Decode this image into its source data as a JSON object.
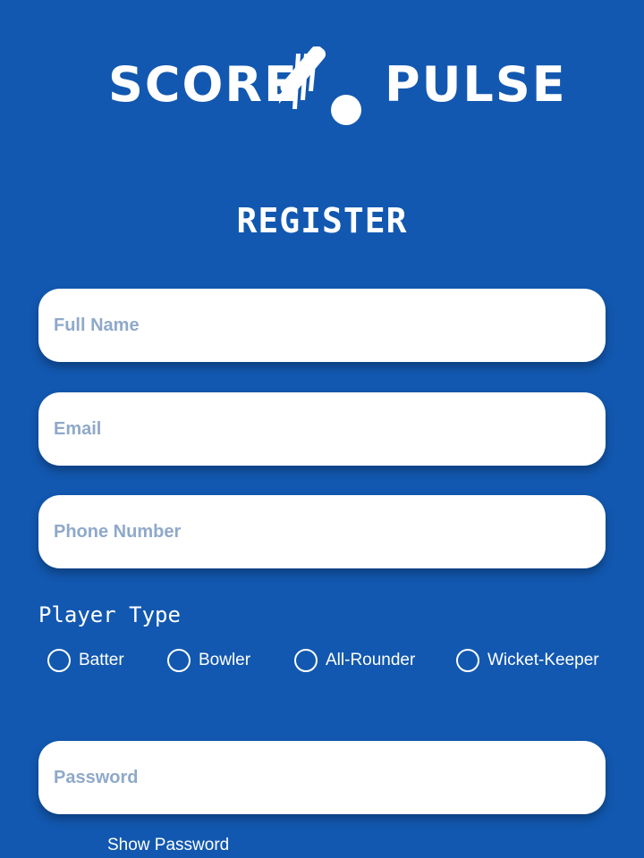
{
  "logo": {
    "word_left": "SCORE",
    "word_right": "PULSE",
    "icon": "cricket-bat-ball-icon"
  },
  "title": "REGISTER",
  "form": {
    "full_name_placeholder": "Full Name",
    "email_placeholder": "Email",
    "phone_placeholder": "Phone Number",
    "player_type_label": "Player Type",
    "player_types": [
      "Batter",
      "Bowler",
      "All-Rounder",
      "Wicket-Keeper"
    ],
    "password_placeholder": "Password",
    "show_password_label": "Show Password"
  },
  "colors": {
    "background": "#1258b0",
    "field_background": "#ffffff",
    "placeholder": "#8fa9c9",
    "text_on_background": "#ffffff"
  }
}
